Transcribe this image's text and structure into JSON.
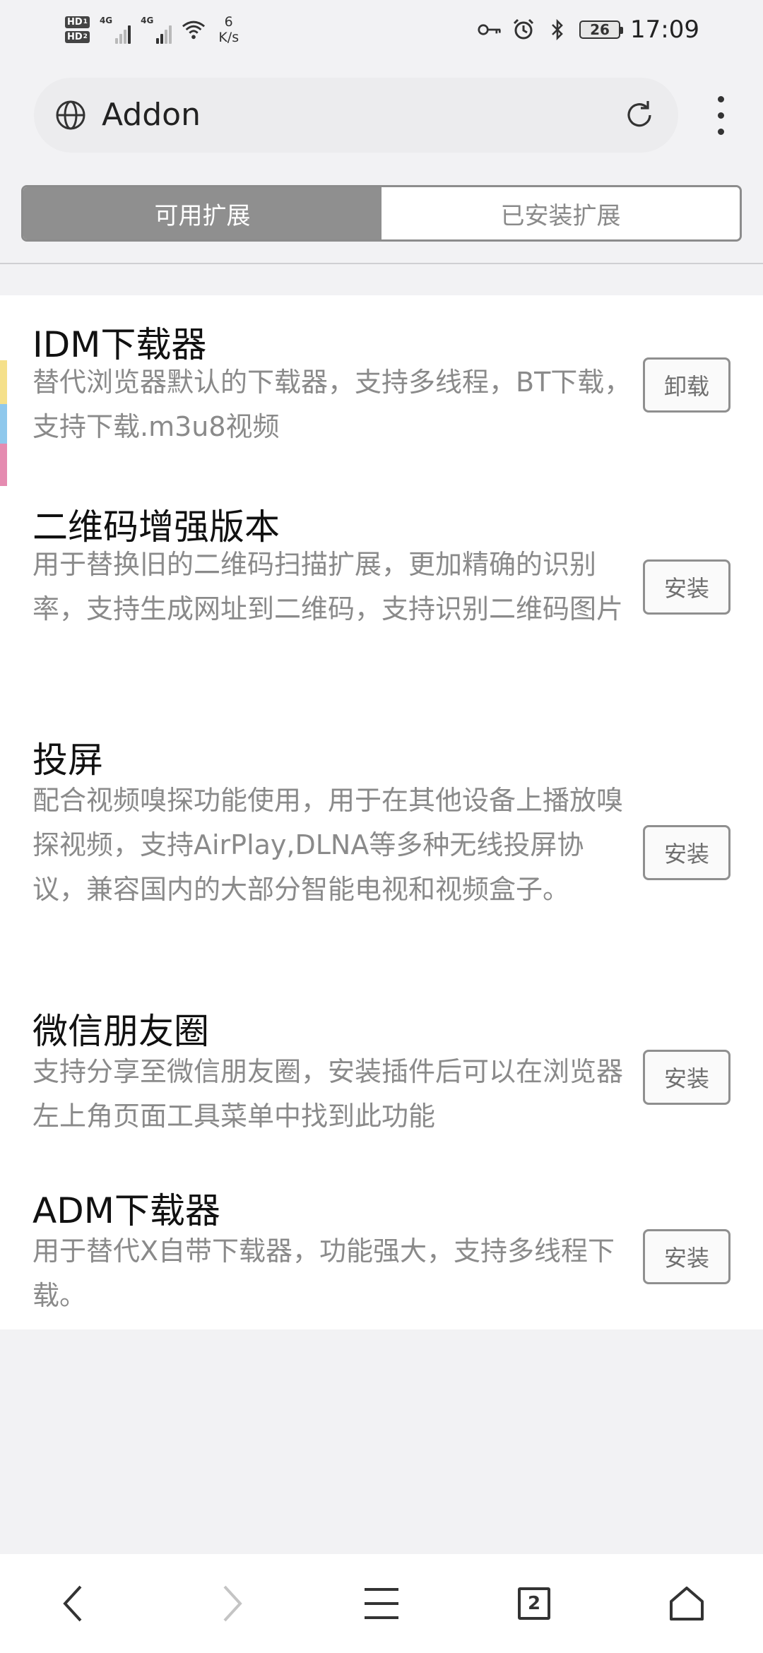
{
  "status_bar": {
    "hd1": "HD",
    "hd1_sub": "1",
    "hd2": "HD",
    "hd2_sub": "2",
    "net1": "4G",
    "net2": "4G",
    "speed_value": "6",
    "speed_unit": "K/s",
    "battery": "26",
    "time": "17:09",
    "icons": [
      "key-icon",
      "alarm-icon",
      "bluetooth-icon",
      "wifi-icon"
    ]
  },
  "address_bar": {
    "title": "Addon",
    "icons": [
      "globe-icon",
      "reload-icon",
      "more-vert-icon"
    ]
  },
  "tabs": [
    {
      "label": "可用扩展",
      "active": true
    },
    {
      "label": "已安装扩展",
      "active": false
    }
  ],
  "extensions": [
    {
      "title": "IDM下载器",
      "description": "替代浏览器默认的下载器，支持多线程，BT下载，支持下载.m3u8视频",
      "button": "卸载"
    },
    {
      "title": "二维码增强版本",
      "description": "用于替换旧的二维码扫描扩展，更加精确的识别率，支持生成网址到二维码，支持识别二维码图片",
      "button": "安装"
    },
    {
      "title": "投屏",
      "description": "配合视频嗅探功能使用，用于在其他设备上播放嗅探视频，支持AirPlay,DLNA等多种无线投屏协议，兼容国内的大部分智能电视和视频盒子。",
      "button": "安装"
    },
    {
      "title": "微信朋友圈",
      "description": "支持分享至微信朋友圈，安装插件后可以在浏览器左上角页面工具菜单中找到此功能",
      "button": "安装"
    },
    {
      "title": "ADM下载器",
      "description": "用于替代X自带下载器，功能强大，支持多线程下载。",
      "button": "安装"
    }
  ],
  "bottom_nav": {
    "tab_count": "2",
    "icons": [
      "back-icon",
      "forward-icon",
      "menu-icon",
      "tabs-icon",
      "home-icon"
    ]
  },
  "colors": {
    "page_bg": "#f2f2f4",
    "tab_active_bg": "#8f8f8f",
    "description_text": "#8a8a8a",
    "stripe_yellow": "#f5e08a",
    "stripe_blue": "#8fc8ec",
    "stripe_pink": "#e58bb0"
  }
}
